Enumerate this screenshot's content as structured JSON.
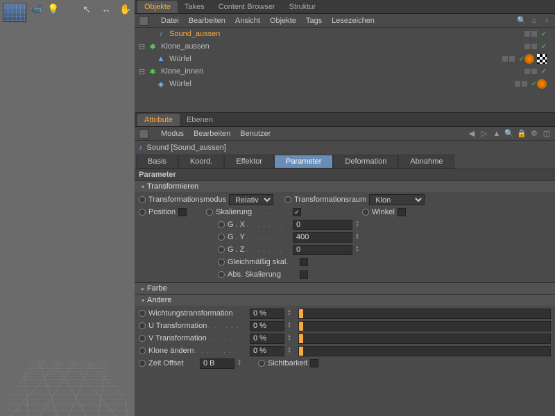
{
  "top_tabs": [
    "Objekte",
    "Takes",
    "Content Browser",
    "Struktur"
  ],
  "top_tabs_active": 0,
  "obj_menubar": [
    "Datei",
    "Bearbeiten",
    "Ansicht",
    "Objekte",
    "Tags",
    "Lesezeichen"
  ],
  "hierarchy": [
    {
      "indent": 1,
      "name": "Sound_aussen",
      "icon": "sound",
      "selected": true,
      "exp": ""
    },
    {
      "indent": 0,
      "name": "Klone_aussen",
      "icon": "cloner",
      "exp": "⊟"
    },
    {
      "indent": 1,
      "name": "Würfel",
      "icon": "emitter",
      "exp": "",
      "tags": [
        "orange",
        "checker"
      ]
    },
    {
      "indent": 0,
      "name": "Klone_innen",
      "icon": "cloner",
      "exp": "⊟"
    },
    {
      "indent": 1,
      "name": "Würfel",
      "icon": "cube",
      "exp": "",
      "tags": [
        "orange"
      ]
    }
  ],
  "attr_tabs": [
    "Attribute",
    "Ebenen"
  ],
  "attr_tabs_active": 0,
  "attr_menubar": [
    "Modus",
    "Bearbeiten",
    "Benutzer"
  ],
  "object_title": "Sound [Sound_aussen]",
  "subtabs": [
    "Basis",
    "Koord.",
    "Effektor",
    "Parameter",
    "Deformation",
    "Abnahme"
  ],
  "subtabs_active": 3,
  "section_header": "Parameter",
  "group_transform": "Transformieren",
  "group_color": "Farbe",
  "group_other": "Andere",
  "labels": {
    "trans_mode": "Transformationsmodus",
    "trans_space": "Transformationsraum",
    "position": "Position",
    "scale": "Skalierung",
    "angle": "Winkel",
    "gx": "G . X",
    "gy": "G . Y",
    "gz": "G . Z",
    "uniform": "Gleichmäßig skal.",
    "abs_scale": "Abs. Skalierung",
    "weight_trans": "Wichtungstransformation",
    "u_trans": "U Transformation",
    "v_trans": "V Transformation",
    "modify_clone": "Klone ändern",
    "time_offset": "Zeit Offset",
    "visibility": "Sichtbarkeit"
  },
  "values": {
    "trans_mode": "Relativ",
    "trans_space": "Klon",
    "gx": "0",
    "gy": "400",
    "gz": "0",
    "weight_trans": "0 %",
    "u_trans": "0 %",
    "v_trans": "0 %",
    "modify_clone": "0 %",
    "time_offset": "0 B",
    "scale_checked": "✓"
  }
}
